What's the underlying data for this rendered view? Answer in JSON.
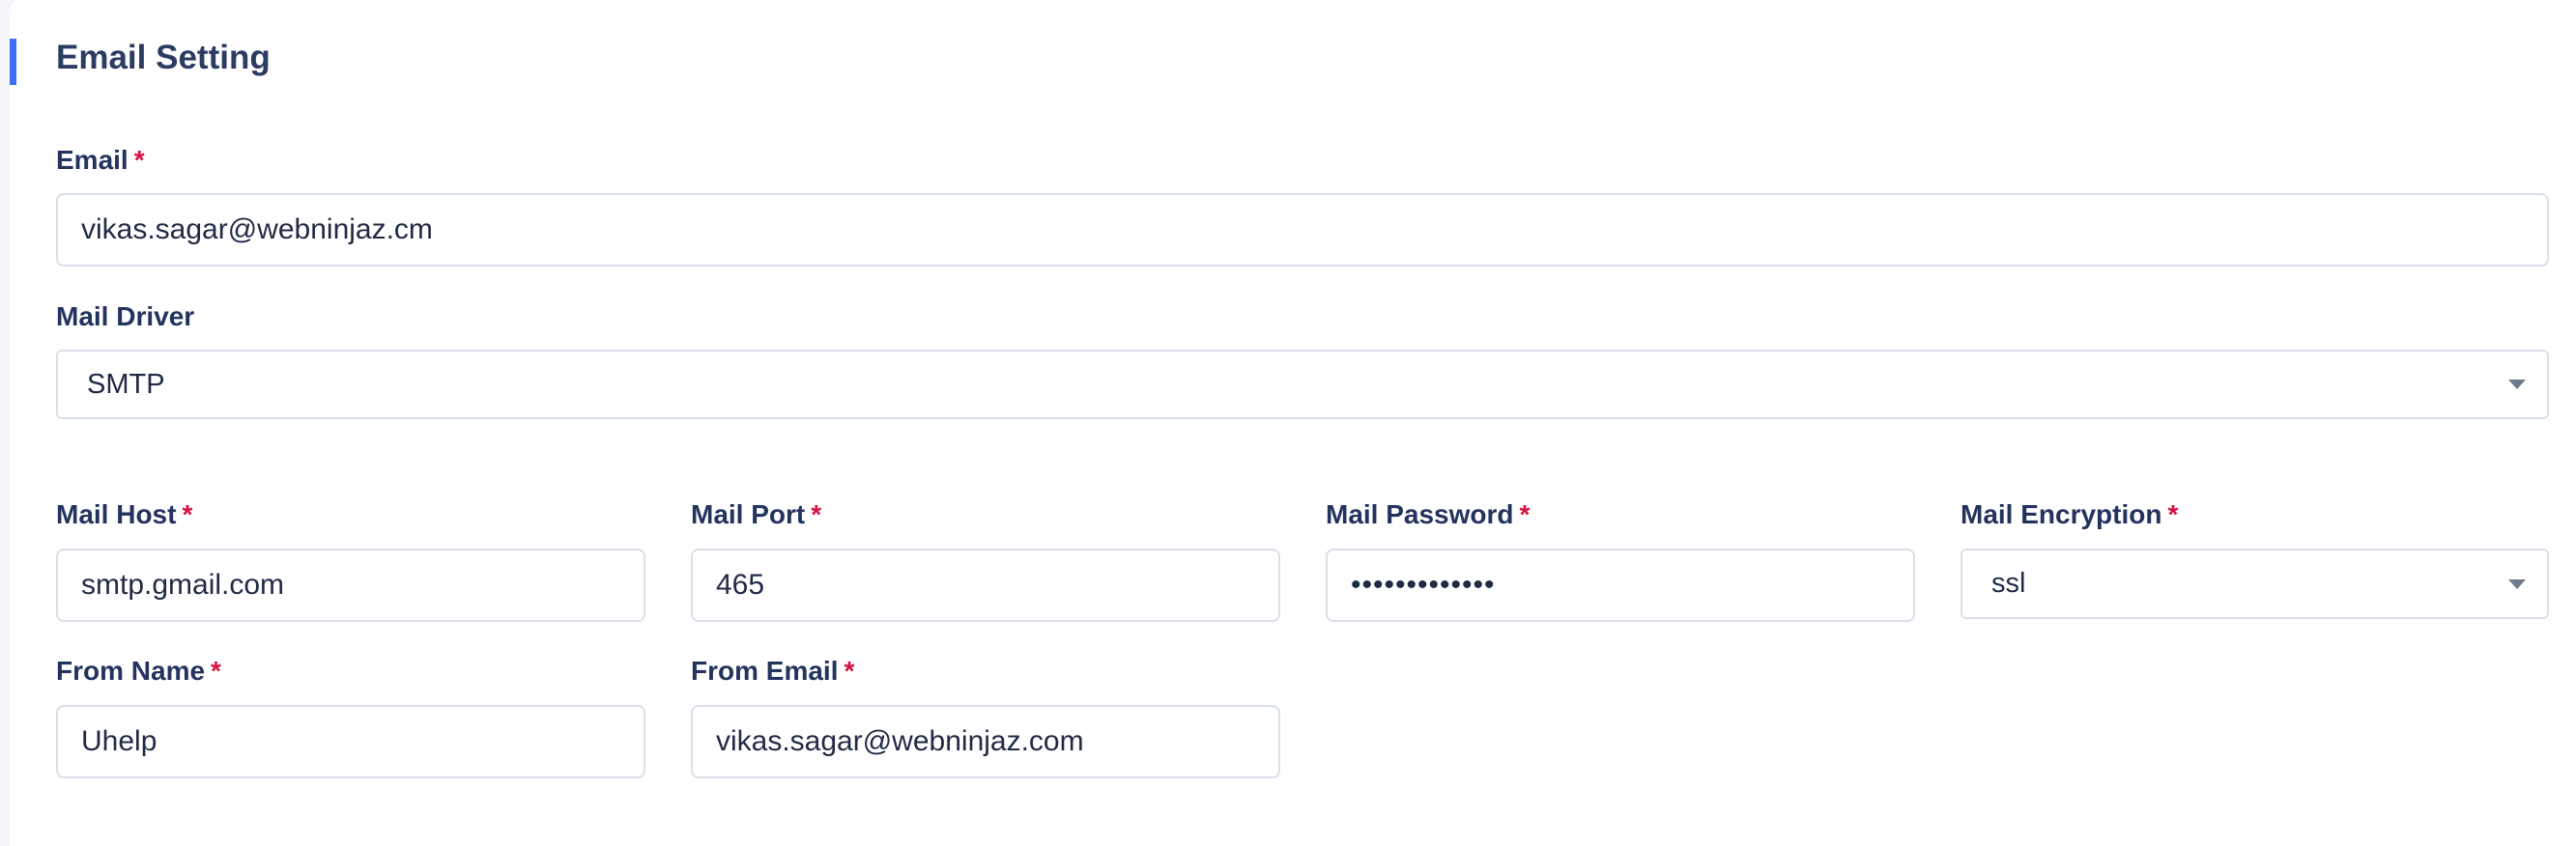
{
  "section": {
    "title": "Email Setting"
  },
  "required_mark": "*",
  "fields": {
    "email": {
      "label": "Email",
      "value": "vikas.sagar@webninjaz.cm"
    },
    "mail_driver": {
      "label": "Mail Driver",
      "value": "SMTP"
    },
    "mail_host": {
      "label": "Mail Host",
      "value": "smtp.gmail.com"
    },
    "mail_port": {
      "label": "Mail Port",
      "value": "465"
    },
    "mail_password": {
      "label": "Mail Password",
      "value": "•••••••••••••"
    },
    "mail_encryption": {
      "label": "Mail Encryption",
      "value": "ssl"
    },
    "from_name": {
      "label": "From Name",
      "value": "Uhelp"
    },
    "from_email": {
      "label": "From Email",
      "value": "vikas.sagar@webninjaz.com"
    }
  },
  "colors": {
    "accent": "#3f6ef6",
    "required": "#d6103f",
    "label": "#23335e",
    "border": "#d9e0ea"
  },
  "icons": {
    "select_caret": "caret-down-icon"
  }
}
